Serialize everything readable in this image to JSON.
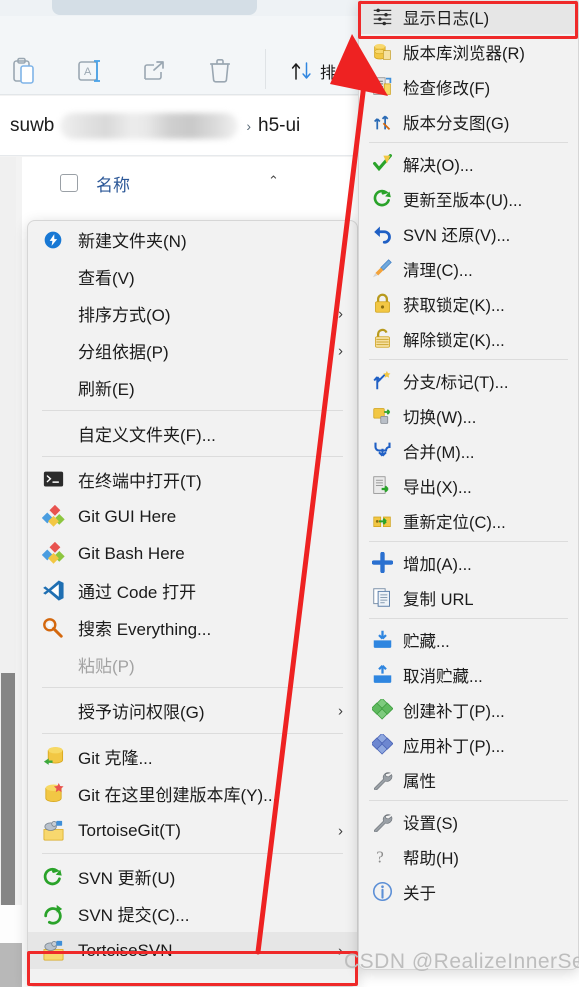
{
  "window": {
    "toolbar": {
      "icons": [
        {
          "name": "paste-icon",
          "label": "粘贴"
        },
        {
          "name": "rename-icon",
          "label": "重命名"
        },
        {
          "name": "share-icon",
          "label": "共享"
        },
        {
          "name": "delete-icon",
          "label": "删除"
        }
      ],
      "sort_label": "排"
    },
    "address_bar": {
      "crumb_first": "suwb",
      "crumb_redacted": "",
      "separator": "›",
      "crumb_last": "h5-ui"
    },
    "list_header": {
      "name_column": "名称",
      "sort_caret": "⌃"
    }
  },
  "context_menu": {
    "items": [
      {
        "icon": "new-folder-icon",
        "label": "新建文件夹(N)",
        "submenu": false,
        "disabled": false,
        "hovered": false
      },
      {
        "icon": "view-icon",
        "label": "查看(V)",
        "submenu": true,
        "disabled": false,
        "hovered": false
      },
      {
        "icon": "sort-by-icon",
        "label": "排序方式(O)",
        "submenu": true,
        "disabled": false,
        "hovered": false
      },
      {
        "icon": "group-by-icon",
        "label": "分组依据(P)",
        "submenu": true,
        "disabled": false,
        "hovered": false
      },
      {
        "icon": "refresh-icon",
        "label": "刷新(E)",
        "submenu": false,
        "disabled": false,
        "hovered": false
      },
      {
        "separator": true
      },
      {
        "icon": "customize-folder-icon",
        "label": "自定义文件夹(F)...",
        "submenu": false,
        "disabled": false,
        "hovered": false
      },
      {
        "separator": true
      },
      {
        "icon": "terminal-icon",
        "label": "在终端中打开(T)",
        "submenu": false,
        "disabled": false,
        "hovered": false
      },
      {
        "icon": "git-gui-icon",
        "label": "Git GUI Here",
        "submenu": false,
        "disabled": false,
        "hovered": false
      },
      {
        "icon": "git-bash-icon",
        "label": "Git Bash Here",
        "submenu": false,
        "disabled": false,
        "hovered": false
      },
      {
        "icon": "vscode-icon",
        "label": "通过 Code 打开",
        "submenu": false,
        "disabled": false,
        "hovered": false
      },
      {
        "icon": "everything-search-icon",
        "label": "搜索 Everything...",
        "submenu": false,
        "disabled": false,
        "hovered": false
      },
      {
        "icon": "paste-menu-icon",
        "label": "粘贴(P)",
        "submenu": false,
        "disabled": true,
        "hovered": false
      },
      {
        "separator": true
      },
      {
        "icon": "grant-access-icon",
        "label": "授予访问权限(G)",
        "submenu": true,
        "disabled": false,
        "hovered": false
      },
      {
        "separator": true
      },
      {
        "icon": "git-clone-icon",
        "label": "Git 克隆...",
        "submenu": false,
        "disabled": false,
        "hovered": false
      },
      {
        "icon": "git-create-repo-icon",
        "label": "Git 在这里创建版本库(Y)...",
        "submenu": false,
        "disabled": false,
        "hovered": false
      },
      {
        "icon": "tortoisegit-icon",
        "label": "TortoiseGit(T)",
        "submenu": true,
        "disabled": false,
        "hovered": false
      },
      {
        "separator": true
      },
      {
        "icon": "svn-update-icon",
        "label": "SVN 更新(U)",
        "submenu": false,
        "disabled": false,
        "hovered": false
      },
      {
        "icon": "svn-commit-icon",
        "label": "SVN 提交(C)...",
        "submenu": false,
        "disabled": false,
        "hovered": false
      },
      {
        "icon": "tortoisesvn-icon",
        "label": "TortoiseSVN",
        "submenu": true,
        "disabled": false,
        "hovered": true
      }
    ]
  },
  "svn_submenu": {
    "items": [
      {
        "icon": "show-log-icon",
        "label": "显示日志(L)",
        "hovered": true
      },
      {
        "icon": "repo-browser-icon",
        "label": "版本库浏览器(R)",
        "hovered": false
      },
      {
        "icon": "check-modifications-icon",
        "label": "检查修改(F)",
        "hovered": false
      },
      {
        "icon": "revision-graph-icon",
        "label": "版本分支图(G)",
        "hovered": false
      },
      {
        "separator": true
      },
      {
        "icon": "resolve-icon",
        "label": "解决(O)...",
        "hovered": false
      },
      {
        "icon": "update-to-revision-icon",
        "label": "更新至版本(U)...",
        "hovered": false
      },
      {
        "icon": "svn-revert-icon",
        "label": "SVN 还原(V)...",
        "hovered": false
      },
      {
        "icon": "cleanup-icon",
        "label": "清理(C)...",
        "hovered": false
      },
      {
        "icon": "get-lock-icon",
        "label": "获取锁定(K)...",
        "hovered": false
      },
      {
        "icon": "release-lock-icon",
        "label": "解除锁定(K)...",
        "hovered": false
      },
      {
        "separator": true
      },
      {
        "icon": "branch-tag-icon",
        "label": "分支/标记(T)...",
        "hovered": false
      },
      {
        "icon": "switch-icon",
        "label": "切换(W)...",
        "hovered": false
      },
      {
        "icon": "merge-icon",
        "label": "合并(M)...",
        "hovered": false
      },
      {
        "icon": "export-icon",
        "label": "导出(X)...",
        "hovered": false
      },
      {
        "icon": "relocate-icon",
        "label": "重新定位(C)...",
        "hovered": false
      },
      {
        "separator": true
      },
      {
        "icon": "add-icon",
        "label": "增加(A)...",
        "hovered": false
      },
      {
        "icon": "copy-url-icon",
        "label": "复制 URL",
        "hovered": false
      },
      {
        "separator": true
      },
      {
        "icon": "shelve-icon",
        "label": "贮藏...",
        "hovered": false
      },
      {
        "icon": "unshelve-icon",
        "label": "取消贮藏...",
        "hovered": false
      },
      {
        "icon": "create-patch-icon",
        "label": "创建补丁(P)...",
        "hovered": false
      },
      {
        "icon": "apply-patch-icon",
        "label": "应用补丁(P)...",
        "hovered": false
      },
      {
        "icon": "properties-icon",
        "label": "属性",
        "hovered": false
      },
      {
        "separator": true
      },
      {
        "icon": "settings-icon",
        "label": "设置(S)",
        "hovered": false
      },
      {
        "icon": "help-icon",
        "label": "帮助(H)",
        "hovered": false
      },
      {
        "icon": "about-icon",
        "label": "关于",
        "hovered": false
      }
    ]
  },
  "annotations": {
    "highlight_color": "#ef2929",
    "arrow_color": "#ee2222",
    "boxed_items": [
      "显示日志(L)",
      "TortoiseSVN"
    ]
  },
  "watermark": {
    "text": "CSDN @RealizeInnerSelf ˋ"
  }
}
